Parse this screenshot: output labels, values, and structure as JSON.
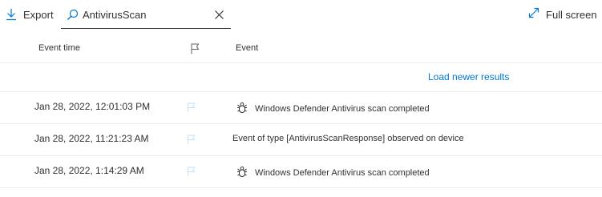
{
  "toolbar": {
    "export_label": "Export",
    "search_value": "AntivirusScan",
    "fullscreen_label": "Full screen"
  },
  "columns": {
    "event_time": "Event time",
    "flag_icon": "flag-icon",
    "event": "Event"
  },
  "load_newer": "Load newer results",
  "rows": [
    {
      "time": "Jan 28, 2022, 12:01:03 PM",
      "event": "Windows Defender Antivirus scan completed",
      "icon": "bug-icon"
    },
    {
      "time": "Jan 28, 2022, 11:21:23 AM",
      "event": "Event of type [AntivirusScanResponse] observed on device",
      "icon": ""
    },
    {
      "time": "Jan 28, 2022, 1:14:29 AM",
      "event": "Windows Defender Antivirus scan completed",
      "icon": "bug-icon"
    }
  ],
  "colors": {
    "accent": "#0078d4",
    "text": "#323130",
    "divider": "#edebe9",
    "flag_muted": "#c7e0f4"
  }
}
